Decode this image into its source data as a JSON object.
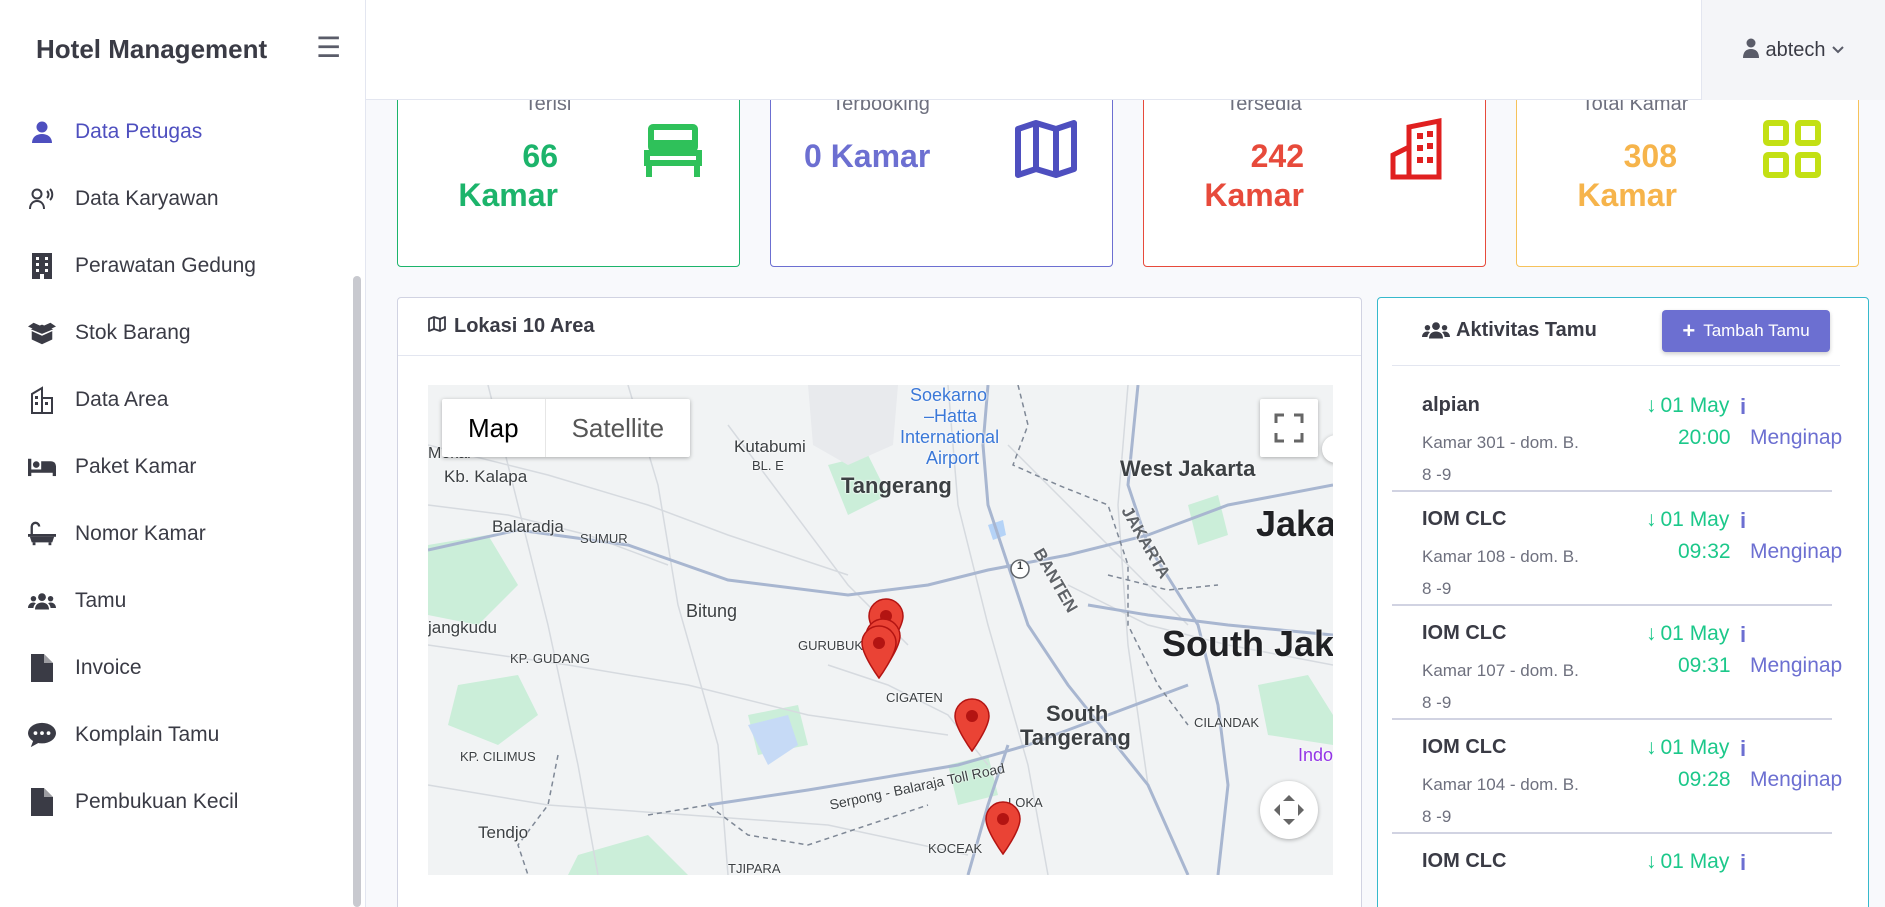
{
  "sidebar": {
    "brand": "Hotel Management",
    "items": [
      {
        "label": "Data Petugas",
        "icon": "user-icon",
        "active": true
      },
      {
        "label": "Data Karyawan",
        "icon": "user-voice-icon"
      },
      {
        "label": "Perawatan Gedung",
        "icon": "building-icon"
      },
      {
        "label": "Stok Barang",
        "icon": "box-open-icon"
      },
      {
        "label": "Data Area",
        "icon": "city-icon"
      },
      {
        "label": "Paket Kamar",
        "icon": "bed-icon"
      },
      {
        "label": "Nomor Kamar",
        "icon": "bath-icon"
      },
      {
        "label": "Tamu",
        "icon": "users-icon"
      },
      {
        "label": "Invoice",
        "icon": "file-icon"
      },
      {
        "label": "Komplain Tamu",
        "icon": "comment-dots-icon"
      },
      {
        "label": "Pembukuan Kecil",
        "icon": "file-icon"
      }
    ]
  },
  "topbar": {
    "username": "abtech"
  },
  "stats": [
    {
      "label": "Terisi",
      "value": "66",
      "unit": "Kamar",
      "color": "#1cb46b",
      "icon": "bed-icon"
    },
    {
      "label": "Terbooking",
      "value": "0",
      "unit": "Kamar",
      "color": "#6c6fd1",
      "icon": "map-icon"
    },
    {
      "label": "Tersedia",
      "value": "242",
      "unit": "Kamar",
      "color": "#e74a3b",
      "icon": "building-icon"
    },
    {
      "label": "Total Kamar",
      "value": "308",
      "unit": "Kamar",
      "color": "#f6b44b",
      "icon": "grid-icon"
    }
  ],
  "map_panel": {
    "title": "Lokasi 10 Area",
    "map_type_map": "Map",
    "map_type_satellite": "Satellite",
    "labels": [
      "Soekarno",
      "–Hatta",
      "International",
      "Airport",
      "Kutabumi",
      "BL. E",
      "Tangerang",
      "West Jakarta",
      "Jaka",
      "Kb. Kalapa",
      "Balaradja",
      "SUMUR",
      "BANTEN",
      "JAKARTA",
      "Bitung",
      "GURUBUK",
      "jangkudu",
      "KP. GUDANG",
      "South Jak",
      "CIGATEN",
      "South",
      "Tangerang",
      "CILANDAK",
      "KP. CILIMUS",
      "Serpong - Balaraja Toll Road",
      "LOKA",
      "Indo",
      "Tendjo",
      "KOCEAK",
      "TJIPARA",
      "Mekar",
      "1"
    ]
  },
  "guests_panel": {
    "title": "Aktivitas Tamu",
    "add_button": "Tambah Tamu",
    "guests": [
      {
        "name": "alpian",
        "room": "Kamar 301 - dom. B. 8 -9",
        "date": "01 May",
        "time": "20:00",
        "status": "Menginap"
      },
      {
        "name": "IOM CLC",
        "room": "Kamar 108 - dom. B. 8 -9",
        "date": "01 May",
        "time": "09:32",
        "status": "Menginap"
      },
      {
        "name": "IOM CLC",
        "room": "Kamar 107 - dom. B. 8 -9",
        "date": "01 May",
        "time": "09:31",
        "status": "Menginap"
      },
      {
        "name": "IOM CLC",
        "room": "Kamar 104 - dom. B. 8 -9",
        "date": "01 May",
        "time": "09:28",
        "status": "Menginap"
      },
      {
        "name": "IOM CLC",
        "room": "",
        "date": "01 May",
        "time": "",
        "status": ""
      }
    ],
    "info_glyph": "i"
  }
}
